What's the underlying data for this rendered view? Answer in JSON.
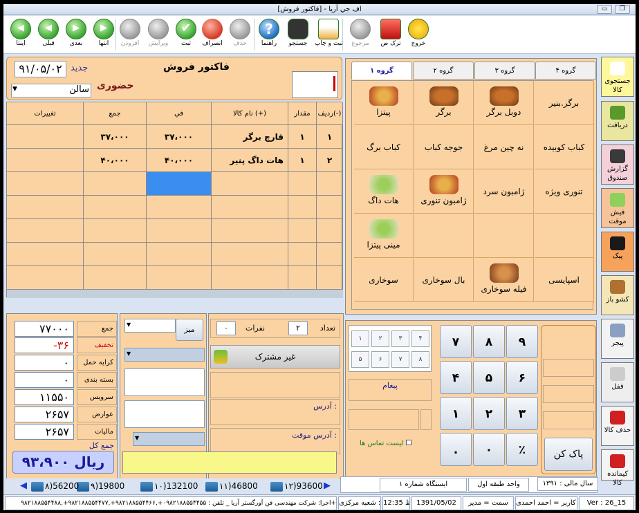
{
  "window": {
    "title": "اف جي آريا - [فاكتور فروش]"
  },
  "toolbar": [
    {
      "label": "اینتا",
      "icon": "first-icon",
      "enabled": true
    },
    {
      "label": "قبلی",
      "icon": "prev-icon",
      "enabled": true
    },
    {
      "label": "بعدی",
      "icon": "next-icon",
      "enabled": true
    },
    {
      "label": "انتها",
      "icon": "last-icon",
      "enabled": true
    },
    {
      "label": "افزودن",
      "icon": "add-icon",
      "enabled": false
    },
    {
      "label": "ویرایش",
      "icon": "edit-icon",
      "enabled": false
    },
    {
      "label": "ثبت",
      "icon": "check-icon",
      "enabled": true
    },
    {
      "label": "انصراف",
      "icon": "cancel-icon",
      "enabled": true
    },
    {
      "label": "حذف",
      "icon": "delete-icon",
      "enabled": false
    },
    {
      "label": "راهنما",
      "icon": "help-icon",
      "enabled": true
    },
    {
      "label": "جستجو",
      "icon": "binoculars-icon",
      "enabled": true
    },
    {
      "label": "ثبت و چاپ",
      "icon": "print-icon",
      "enabled": true
    },
    {
      "label": "مرجوع",
      "icon": "return-icon",
      "enabled": false
    },
    {
      "label": "ترک ص",
      "icon": "lock-icon",
      "enabled": true
    },
    {
      "label": "خروج",
      "icon": "exit-icon",
      "enabled": true
    }
  ],
  "header": {
    "title": "فاکتور فروش",
    "new_label": "جديد",
    "date": "۹۱/۰۵/۰۲",
    "order_type": "حضوری",
    "hall": "سالن"
  },
  "grid": {
    "columns": [
      "رديف(-)",
      "مقدار",
      "نام كالا (+)",
      "في",
      "جمع",
      "تغييرات"
    ],
    "rows": [
      {
        "row": "۱",
        "qty": "۱",
        "name": "قارچ برگر",
        "price": "۳۷،۰۰۰",
        "total": "۳۷،۰۰۰",
        "changes": ""
      },
      {
        "row": "۲",
        "qty": "۱",
        "name": "هات داگ پنیر",
        "price": "۴۰،۰۰۰",
        "total": "۴۰،۰۰۰",
        "changes": ""
      }
    ]
  },
  "groups": {
    "tabs": [
      "گروه ۱",
      "گروه ۲",
      "گروه ۳",
      "گروه ۴"
    ],
    "active": 0,
    "items": [
      {
        "label": "برگر.بنیر",
        "img": ""
      },
      {
        "label": "دوبل برگر",
        "img": "burger-icon"
      },
      {
        "label": "برگر",
        "img": "burger-icon"
      },
      {
        "label": "پیتزا",
        "img": "pizza-icon"
      },
      {
        "label": "کباب کوبیده",
        "img": ""
      },
      {
        "label": "نه چین مرغ",
        "img": ""
      },
      {
        "label": "جوجه کباب",
        "img": ""
      },
      {
        "label": "کباب برگ",
        "img": ""
      },
      {
        "label": "تنوری ویژه",
        "img": ""
      },
      {
        "label": "ژامبون سرد",
        "img": ""
      },
      {
        "label": "ژامبون تنوری",
        "img": "pizza-icon"
      },
      {
        "label": "هات داگ",
        "img": "salad-icon"
      },
      {
        "label": "",
        "img": ""
      },
      {
        "label": "",
        "img": ""
      },
      {
        "label": "",
        "img": ""
      },
      {
        "label": "مینی پیتزا",
        "img": "salad-icon"
      },
      {
        "label": "اسپایسی",
        "img": ""
      },
      {
        "label": "فیله سوخاری",
        "img": "fried-icon"
      },
      {
        "label": "بال سوخاری",
        "img": ""
      },
      {
        "label": "سوخاری",
        "img": ""
      }
    ]
  },
  "sidebar": [
    {
      "label": "جستجوی کالا",
      "icon": "search-doc-icon",
      "bg": "#fff89a"
    },
    {
      "label": "دريافت",
      "icon": "receive-icon",
      "bg": "#e9e6a0"
    },
    {
      "label": "گزارش صندوق",
      "icon": "report-icon",
      "bg": "#f4d0d8"
    },
    {
      "label": "فیش موقت",
      "icon": "temp-icon",
      "bg": "#f6c49a"
    },
    {
      "label": "پیک",
      "icon": "motorbike-icon",
      "bg": "#f6a25a"
    },
    {
      "label": "کشو باز",
      "icon": "drawer-icon",
      "bg": "#f5e6b8"
    },
    {
      "label": "پیجر",
      "icon": "pager-icon",
      "bg": "#f3f3f3"
    },
    {
      "label": "قفل",
      "icon": "lock-icon",
      "bg": "#eeeeee"
    },
    {
      "label": "حذف کالا",
      "icon": "no-icon",
      "bg": "#f4f4f4"
    },
    {
      "label": "کیماندہ کالا",
      "icon": "x-icon",
      "bg": "#f4f4f4"
    }
  ],
  "totals": {
    "items": [
      {
        "label": "جمع",
        "value": "۷۷۰۰۰"
      },
      {
        "label": "تخفیف",
        "value": "-۳۶"
      },
      {
        "label": "کرايه حمل",
        "value": "۰"
      },
      {
        "label": "بسته بندی",
        "value": "۰"
      },
      {
        "label": "سرويس",
        "value": "۱۱۵۵۰"
      },
      {
        "label": "عوارض",
        "value": "۲۶۵۷"
      },
      {
        "label": "ماليات",
        "value": "۲۶۵۷"
      }
    ],
    "grand_label": "جمع کل",
    "grand_value": "۹۳،۹۰۰ ريال"
  },
  "form": {
    "table_label": "ميز",
    "count_label": "تعداد",
    "count_value": "۲",
    "people_label": "نفرات",
    "people_value": "۰",
    "customer": "غیر مشترک",
    "address_label": "آدرس :",
    "temp_address_label": "آدرس موقت :",
    "message_label": "پيغام",
    "contacts_label": "ليست تماس ها"
  },
  "keypad": {
    "keys": [
      "۹",
      "۸",
      "۷",
      "۶",
      "۵",
      "۴",
      "۳",
      "۲",
      "۱",
      "٪",
      "۰",
      "."
    ],
    "small": [
      "۴",
      "۳",
      "۲",
      "۱",
      "۸",
      "۷",
      "۶",
      "۵"
    ],
    "clear": "پاک کن"
  },
  "tables_bar": [
    {
      "label": "۱۲)93600"
    },
    {
      "label": "۱۱)46800"
    },
    {
      "label": "۱۰)132100"
    },
    {
      "label": "۹)19800"
    },
    {
      "label": "۸)56200"
    }
  ],
  "status": {
    "fiscal_year": "سال مالی : ۱۳۹۱",
    "unit": "واحد طبقه اول",
    "station": "ایستگاه شماره ۱",
    "version": "Ver : 26_15",
    "user": "نام كاربر = احمد احمدی",
    "role": "سمت = مدير",
    "date": "1391/05/02",
    "time": "ب.ظ 12:35",
    "branch": "شعبه : شعبه مركزی",
    "credit": "اجرا: شركت مهندسی فن آورگستر آريا _ تلفن : ۰۹۸۲۱۸۸۵۵۴۴۵۵+,۹۸۲۱۸۸۵۵۴۴۶۶+,۹۸۲۱۸۸۵۵۴۴۷۷+,۹۸۲۱۸۸۵۵۴۴۸۸+"
  }
}
